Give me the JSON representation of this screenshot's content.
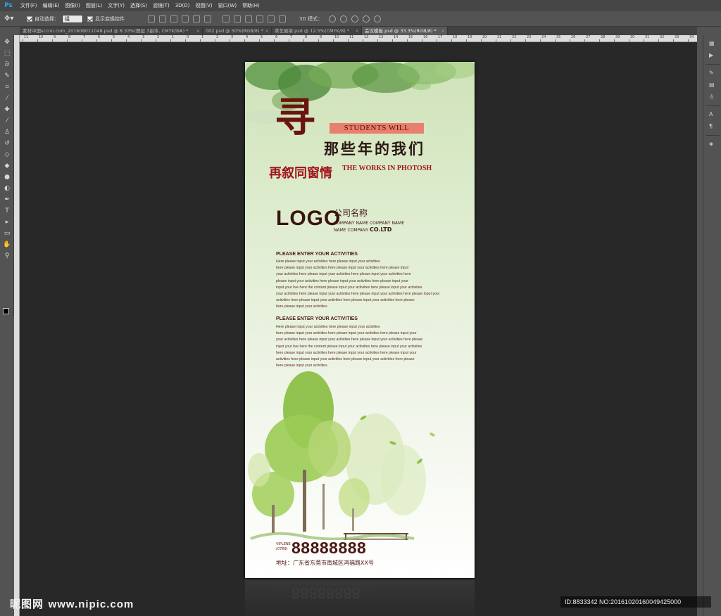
{
  "app": {
    "logo": "Ps"
  },
  "menu": [
    "文件(F)",
    "编辑(E)",
    "图像(I)",
    "图层(L)",
    "文字(Y)",
    "选择(S)",
    "滤镜(T)",
    "3D(D)",
    "视图(V)",
    "窗口(W)",
    "帮助(H)"
  ],
  "options": {
    "auto_select_label": "自动选择：",
    "auto_select_value": "组",
    "show_transform_label": "显示变换控件",
    "mode_3d_label": "3D 模式："
  },
  "tabs": [
    {
      "label": "素材中国sccnn.com_201608011048.psd @ 8.33%(图层 3副本, CMYK/8#) *",
      "active": false
    },
    {
      "label": "002.psd @ 50%(RGB/8) *",
      "active": false
    },
    {
      "label": "茶艺展架.psd @ 12.5%(CMYK/8) *",
      "active": false
    },
    {
      "label": "会议模板.psd @ 33.3%(RGB/8) *",
      "active": true
    }
  ],
  "ruler_top_labels": [
    "11",
    "10",
    "9",
    "8",
    "7",
    "6",
    "5",
    "4",
    "3",
    "2",
    "1",
    "0",
    "1",
    "2",
    "3",
    "4",
    "5",
    "6",
    "7",
    "8",
    "9",
    "10",
    "11",
    "12",
    "13",
    "14",
    "15",
    "16",
    "17",
    "18",
    "19",
    "20",
    "21",
    "22",
    "23",
    "24",
    "25",
    "26",
    "27",
    "28",
    "29",
    "30",
    "31",
    "32",
    "33",
    "34"
  ],
  "poster": {
    "big_char": "寻",
    "badge": "STUDENTS WILL",
    "calligraphy": "那些年的我们",
    "subtitle_cn": "再叙同窗情",
    "subtitle_en": "THE WORKS IN PHOTOSH",
    "logo": "LOGO",
    "company_cn": "公司名称",
    "company_en1": "COMPANY NAME COMPANY NAME",
    "company_en2": "NAME COMPANY",
    "company_en2_bold": "CO.LTD",
    "section1_title": "PLEASE ENTER YOUR ACTIVITIES",
    "section1_lines": [
      "Here please input your activities here please input your activities",
      "here please input your activities here please input your activities here please input",
      "your activities here please input your activities here please input your activities here",
      "please input your activities here please input your activities here please input your",
      "input your live here the content please input your activities here please input your activities",
      "your activities here please input your activities here please input your activities here please input your",
      " activities here please input your activities here please input your activities here please",
      "here please input your activities"
    ],
    "section2_title": "PLEASE ENTER YOUR ACTIVITIES",
    "section2_lines": [
      "Here please input your activities here please input your activities",
      "here please input your activities here please input your activities here please input your",
      "your activities here please input your activities here please input your activities here please",
      "input your live here the content please input your activities here please input your activities",
      "here please input your activities here please input your activities here please input your",
      " activities here please input your activities here please input your activities here please",
      "here please input your activities"
    ],
    "phone_label_1": "VIPLENE",
    "phone_label_2": "(0769)",
    "phone": "88888888",
    "address": "地址：广东省东莞市南城区鸿福路XX号"
  },
  "watermark": {
    "site_cn": "昵图网",
    "site_url": "www.nipic.com",
    "id_text": "ID:8833342 NO:20161020160049425000"
  },
  "colors": {
    "accent_dark": "#4a1612",
    "accent_red": "#a0141b",
    "badge": "#e9806e",
    "ps_blue": "#2fa3f7"
  }
}
